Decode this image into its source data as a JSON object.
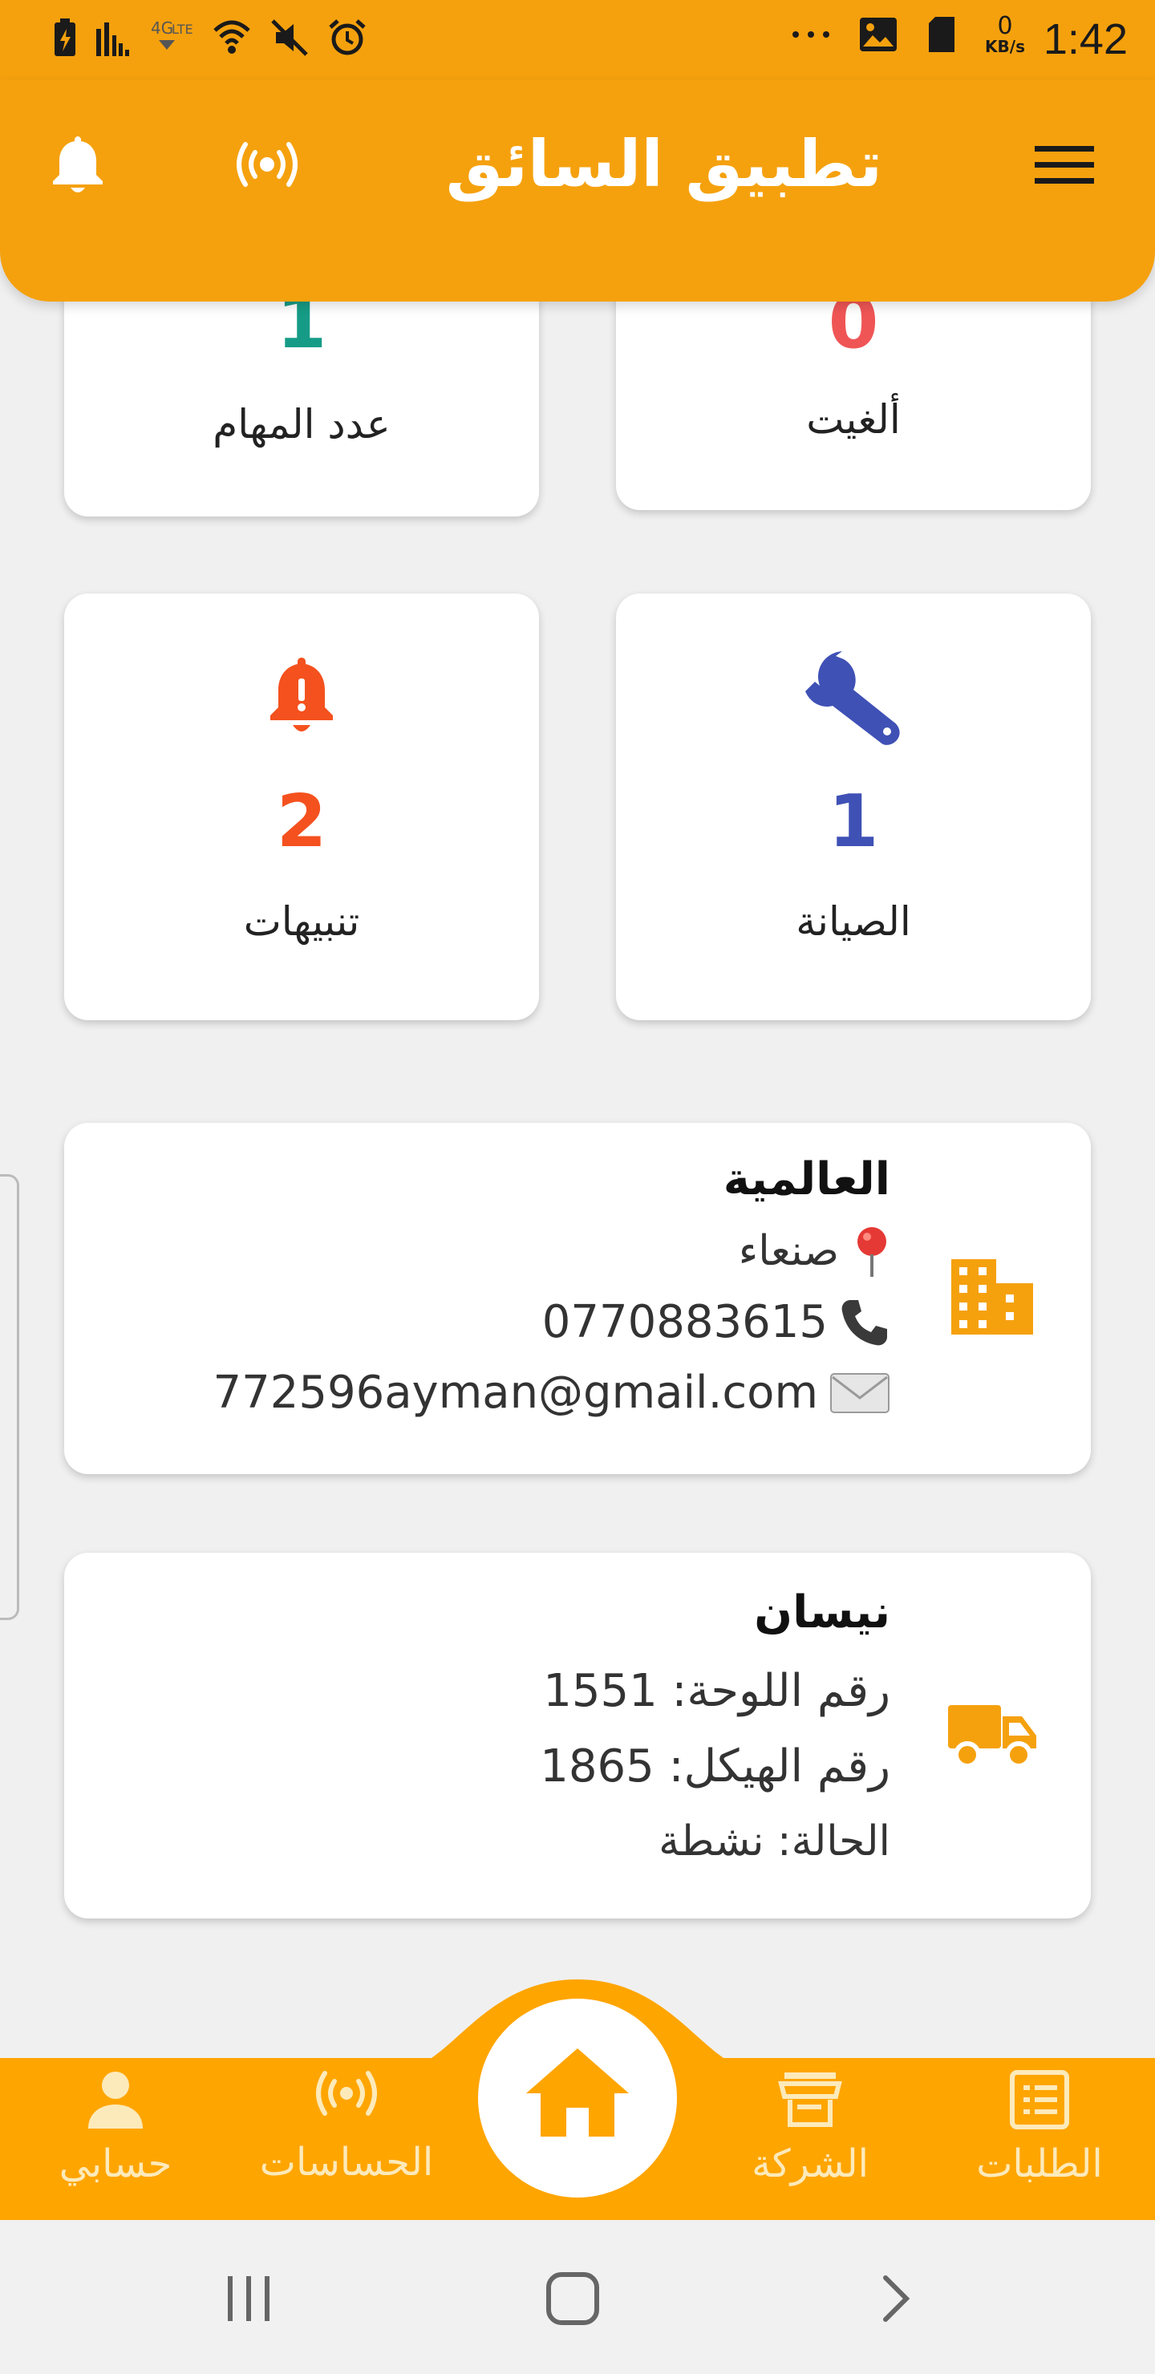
{
  "status_bar": {
    "time": "1:42",
    "net_speed_value": "0",
    "net_speed_unit": "KB/s"
  },
  "app_bar": {
    "title": "تطبيق السائق"
  },
  "stats": {
    "tasks": {
      "value": "1",
      "label": "عدد المهام",
      "color": "#169c86"
    },
    "cancelled": {
      "value": "0",
      "label": "ألغيت",
      "color": "#f05555"
    },
    "alerts": {
      "value": "2",
      "label": "تنبيهات",
      "color": "#f4511e"
    },
    "maintenance": {
      "value": "1",
      "label": "الصيانة",
      "color": "#3f51b5"
    }
  },
  "company": {
    "name": "العالمية",
    "city": "صنعاء",
    "phone": "0770883615",
    "email": "772596ayman@gmail.com"
  },
  "vehicle": {
    "name": "نيسان",
    "plate": "رقم اللوحة: 1551",
    "chassis": "رقم الهيكل: 1865",
    "status": "الحالة: نشطة"
  },
  "bottom_nav": {
    "account": "حسابي",
    "sensors": "الحساسات",
    "company": "الشركة",
    "requests": "الطلبات"
  },
  "colors": {
    "primary": "#f5a10e",
    "nav": "#ffa500",
    "icon_orange": "#f5a10e"
  }
}
